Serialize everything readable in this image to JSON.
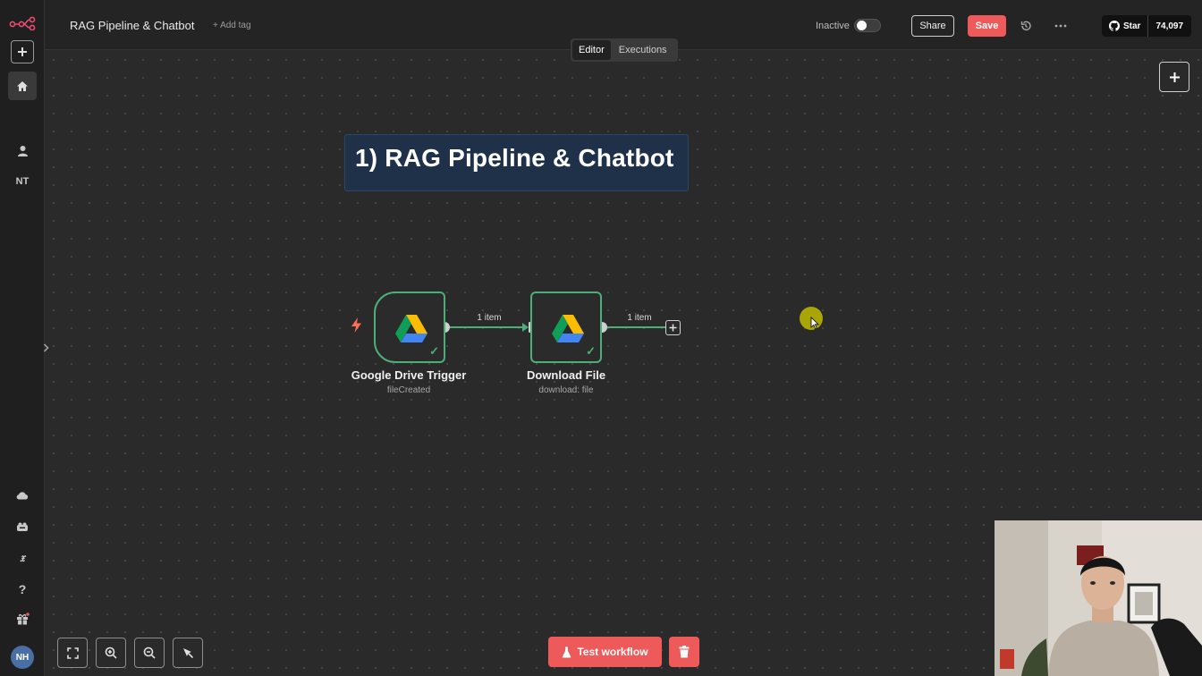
{
  "header": {
    "workflow_title": "RAG Pipeline & Chatbot",
    "add_tag": "+ Add tag",
    "status_label": "Inactive",
    "share_label": "Share",
    "save_label": "Save",
    "github_star": "Star",
    "github_count": "74,097"
  },
  "tabs": [
    {
      "label": "Editor",
      "active": true
    },
    {
      "label": "Executions",
      "active": false
    }
  ],
  "sidebar": {
    "user_initials": "NT",
    "avatar_initials": "NH",
    "icons": [
      "n8n-logo-icon",
      "plus-icon",
      "home-icon",
      "user-icon",
      "cloud-icon",
      "templates-icon",
      "variables-icon",
      "help-icon",
      "gift-icon"
    ]
  },
  "canvas": {
    "sticky_note": "1) RAG Pipeline & Chatbot",
    "nodes": [
      {
        "name": "Google Drive Trigger",
        "subtitle": "fileCreated",
        "type": "trigger"
      },
      {
        "name": "Download File",
        "subtitle": "download: file",
        "type": "action"
      }
    ],
    "connections": [
      {
        "label": "1 item"
      },
      {
        "label": "1 item"
      }
    ]
  },
  "bottom": {
    "test_workflow_label": "Test workflow"
  },
  "colors": {
    "accent": "#ee5a5a",
    "node_success": "#4caf7a",
    "sticky_bg": "#1e3148",
    "canvas_bg": "#2a2a2a"
  }
}
